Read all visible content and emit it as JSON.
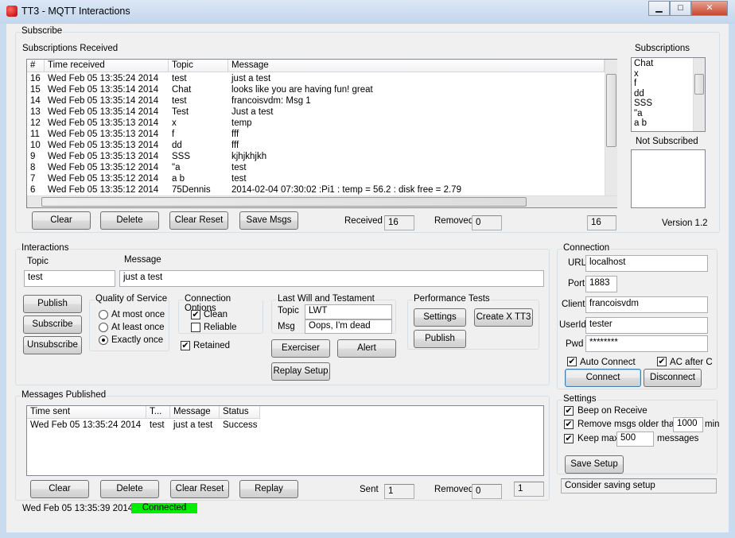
{
  "window": {
    "title": "TT3 - MQTT Interactions",
    "minimize": "▁",
    "maximize": "□",
    "close": "✕"
  },
  "subscribe": {
    "group_label": "Subscribe",
    "received_label": "Subscriptions Received",
    "columns": [
      "#",
      "Time received",
      "Topic",
      "Message"
    ],
    "rows": [
      [
        "16",
        "Wed Feb 05 13:35:24 2014",
        "test",
        "just a test"
      ],
      [
        "15",
        "Wed Feb 05 13:35:14 2014",
        "Chat",
        "looks like you are having fun!  great"
      ],
      [
        "14",
        "Wed Feb 05 13:35:14 2014",
        "test",
        "francoisvdm: Msg 1"
      ],
      [
        "13",
        "Wed Feb 05 13:35:14 2014",
        "Test",
        "Just a test"
      ],
      [
        "12",
        "Wed Feb 05 13:35:13 2014",
        "x",
        "temp"
      ],
      [
        "11",
        "Wed Feb 05 13:35:13 2014",
        "f",
        "fff"
      ],
      [
        "10",
        "Wed Feb 05 13:35:13 2014",
        "dd",
        "fff"
      ],
      [
        "9",
        "Wed Feb 05 13:35:13 2014",
        "SSS",
        "kjhjkhjkh"
      ],
      [
        "8",
        "Wed Feb 05 13:35:12 2014",
        "\"a",
        "test"
      ],
      [
        "7",
        "Wed Feb 05 13:35:12 2014",
        "a b",
        "test"
      ],
      [
        "6",
        "Wed Feb 05 13:35:12 2014",
        "75Dennis",
        "2014-02-04 07:30:02 :Pi1 : temp = 56.2 : disk free = 2.79"
      ]
    ],
    "buttons": {
      "clear": "Clear",
      "delete": "Delete",
      "clear_reset": "Clear  Reset",
      "save": "Save Msgs"
    },
    "received_text": "Received",
    "received": "16",
    "removed_text": "Removed",
    "removed": "0",
    "count": "16",
    "subscriptions_label": "Subscriptions",
    "subscriptions": [
      "Chat",
      "x",
      "f",
      "dd",
      "SSS",
      "\"a",
      "a b"
    ],
    "not_subscribed_label": "Not Subscribed",
    "version": "Version 1.2"
  },
  "interactions": {
    "group_label": "Interactions",
    "topic_label": "Topic",
    "topic": "test",
    "message_label": "Message",
    "message": "just a test",
    "publish": "Publish",
    "subscribe": "Subscribe",
    "unsubscribe": "Unsubscribe",
    "qos_label": "Quality of Service",
    "qos": [
      "At most once",
      "At least once",
      "Exactly once"
    ],
    "qos_selected": "Exactly once",
    "conn_opts_label": "Connection Options",
    "clean": "Clean",
    "clean_checked": true,
    "reliable": "Reliable",
    "reliable_checked": false,
    "retained": "Retained",
    "retained_checked": true,
    "lwt_label": "Last Will and Testament",
    "lwt_topic_label": "Topic",
    "lwt_topic": "LWT",
    "lwt_msg_label": "Msg",
    "lwt_msg": "Oops, I'm dead",
    "exerciser": "Exerciser",
    "alert": "Alert",
    "replay_setup": "Replay Setup",
    "perf_label": "Performance Tests",
    "perf_settings": "Settings",
    "perf_create": "Create X TT3",
    "perf_publish": "Publish"
  },
  "connection": {
    "group_label": "Connection",
    "url_label": "URL",
    "url": "localhost",
    "port_label": "Port",
    "port": "1883",
    "client_label": "Client",
    "client": "francoisvdm",
    "userid_label": "UserId",
    "userid": "tester",
    "pwd_label": "Pwd",
    "pwd": "********",
    "auto_connect": "Auto Connect",
    "ac_after": "AC after C",
    "connect": "Connect",
    "disconnect": "Disconnect"
  },
  "published": {
    "group_label": "Messages Published",
    "columns": [
      "Time sent",
      "T...",
      "Message",
      "Status"
    ],
    "rows": [
      [
        "Wed Feb 05 13:35:24 2014",
        "test",
        "just a test",
        "Success"
      ]
    ],
    "buttons": {
      "clear": "Clear",
      "delete": "Delete",
      "clear_reset": "Clear  Reset",
      "replay": "Replay"
    },
    "sent_text": "Sent",
    "sent": "1",
    "removed_text": "Removed",
    "removed": "0",
    "count": "1"
  },
  "settings": {
    "group_label": "Settings",
    "beep": "Beep on Receive",
    "remove_older": "Remove msgs older than",
    "remove_value": "1000",
    "remove_unit": "min",
    "keep_max": "Keep max",
    "keep_value": "500",
    "keep_unit": "messages",
    "save_setup": "Save Setup",
    "status": "Consider saving setup"
  },
  "statusbar": {
    "time": "Wed Feb 05 13:35:39 2014",
    "connection": "Connected",
    "connection_color": "#00ee00"
  }
}
